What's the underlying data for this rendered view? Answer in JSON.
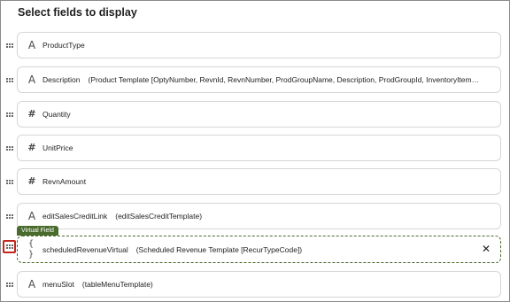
{
  "panel": {
    "title": "Select fields to display"
  },
  "fields": [
    {
      "name": "ProductType",
      "template": "",
      "icon": "text-type-icon"
    },
    {
      "name": "Description",
      "template": "(Product Template [OptyNumber, RevnId, RevnNumber, ProdGroupName, Description, ProdGroupId, InventoryItem…",
      "icon": "text-type-icon"
    },
    {
      "name": "Quantity",
      "template": "",
      "icon": "number-type-icon"
    },
    {
      "name": "UnitPrice",
      "template": "",
      "icon": "number-type-icon"
    },
    {
      "name": "RevnAmount",
      "template": "",
      "icon": "number-type-icon"
    },
    {
      "name": "editSalesCreditLink",
      "template": "(editSalesCreditTemplate)",
      "icon": "text-type-icon"
    },
    {
      "name": "scheduledRevenueVirtual",
      "template": "(Scheduled Revenue Template [RecurTypeCode])",
      "icon": "braces-icon",
      "badge": "Virtual Field"
    },
    {
      "name": "menuSlot",
      "template": "(tableMenuTemplate)",
      "icon": "text-type-icon"
    }
  ],
  "glyphs": {
    "text": "A",
    "number": "#",
    "braces": "{ }",
    "close": "✕"
  },
  "colors": {
    "virtual_accent": "#4a6b2e",
    "focus_outline": "#c1271f"
  }
}
